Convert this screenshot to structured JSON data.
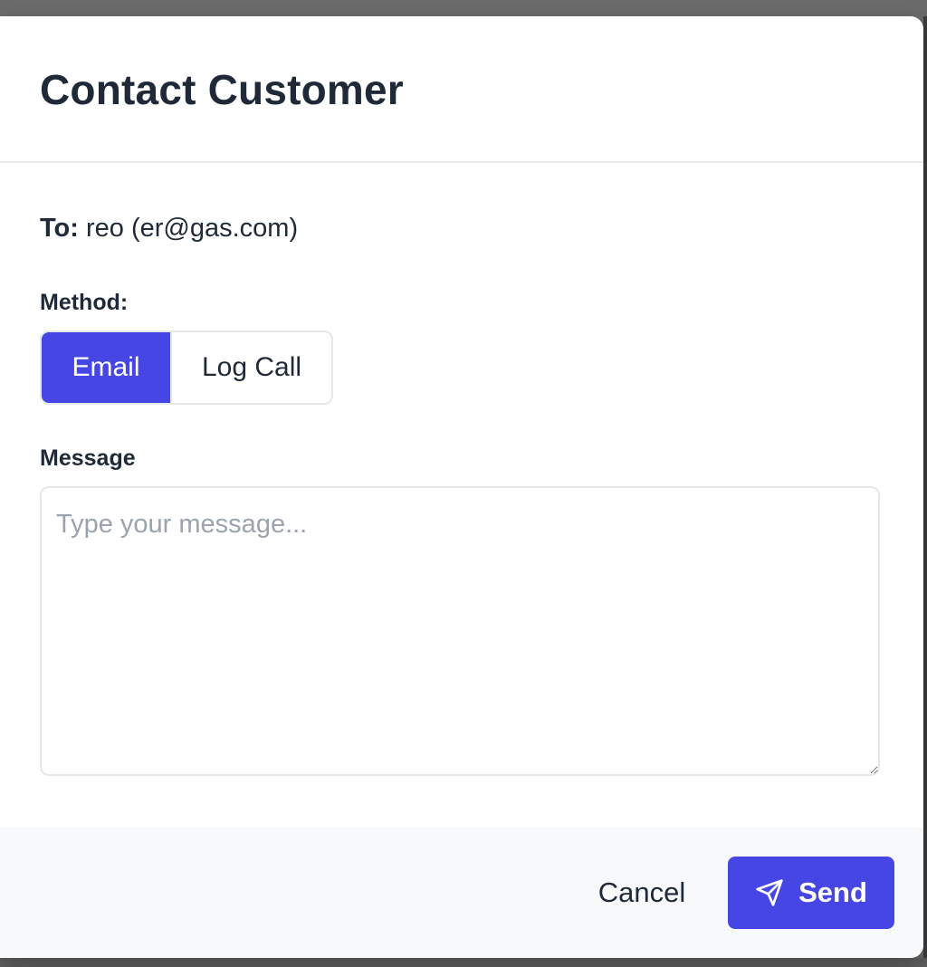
{
  "dialog": {
    "title": "Contact Customer"
  },
  "recipient": {
    "label": "To:",
    "value": "reo (er@gas.com)"
  },
  "method": {
    "label": "Method:",
    "options": [
      "Email",
      "Log Call"
    ],
    "selected": "Email"
  },
  "message": {
    "label": "Message",
    "placeholder": "Type your message...",
    "value": ""
  },
  "footer": {
    "cancel_label": "Cancel",
    "send_label": "Send",
    "send_icon": "paper-plane-icon"
  },
  "colors": {
    "accent": "#4646e5",
    "text": "#1f2937",
    "placeholder": "#9ca3af",
    "border": "#e5e7eb",
    "footer_bg": "#f8f9fb",
    "backdrop": "#6b6b6b"
  }
}
